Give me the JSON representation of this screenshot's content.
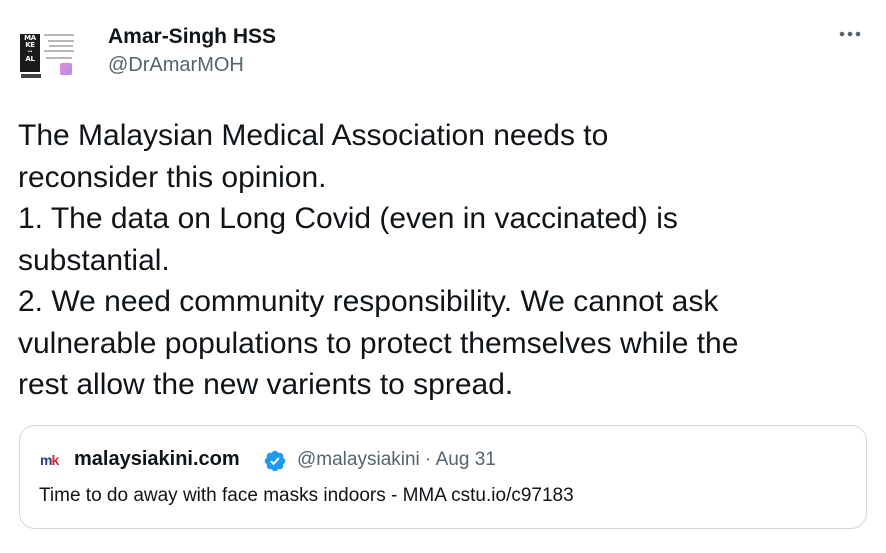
{
  "author": {
    "display_name": "Amar-Singh HSS",
    "handle": "@DrAmarMOH",
    "avatar_icon": "profile-poster-icon"
  },
  "tweet": {
    "lines": [
      "The Malaysian Medical Association needs to",
      "reconsider this opinion.",
      "1. The data on Long Covid (even in vaccinated) is",
      "substantial.",
      "2. We need community responsibility. We cannot ask",
      "vulnerable populations to protect themselves while the",
      "rest allow the new varients to spread."
    ]
  },
  "quote": {
    "logo_m": "m",
    "logo_k": "k",
    "source_name": "malaysiakini.com",
    "handle_date": "@malaysiakini · Aug 31",
    "text": "Time to do away with face masks indoors - MMA cstu.io/c97183",
    "verified_icon": "verified-badge-icon"
  },
  "colors": {
    "text_primary": "#0f1419",
    "text_secondary": "#536471",
    "border": "#cfd9de",
    "verified_blue": "#1d9bf0"
  }
}
